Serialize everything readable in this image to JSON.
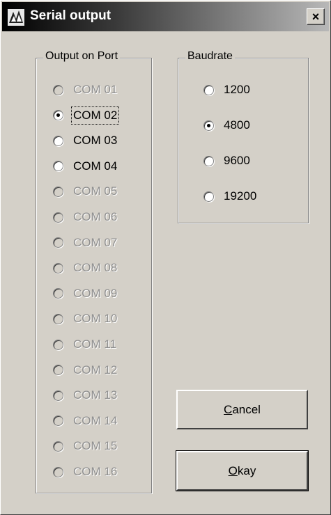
{
  "window": {
    "title": "Serial output",
    "close_symbol": "×"
  },
  "port_group": {
    "legend": "Output on Port",
    "options": [
      {
        "label": "COM 01",
        "enabled": false,
        "checked": false
      },
      {
        "label": "COM 02",
        "enabled": true,
        "checked": true,
        "focused": true
      },
      {
        "label": "COM 03",
        "enabled": true,
        "checked": false
      },
      {
        "label": "COM 04",
        "enabled": true,
        "checked": false
      },
      {
        "label": "COM 05",
        "enabled": false,
        "checked": false
      },
      {
        "label": "COM 06",
        "enabled": false,
        "checked": false
      },
      {
        "label": "COM 07",
        "enabled": false,
        "checked": false
      },
      {
        "label": "COM 08",
        "enabled": false,
        "checked": false
      },
      {
        "label": "COM 09",
        "enabled": false,
        "checked": false
      },
      {
        "label": "COM 10",
        "enabled": false,
        "checked": false
      },
      {
        "label": "COM 11",
        "enabled": false,
        "checked": false
      },
      {
        "label": "COM 12",
        "enabled": false,
        "checked": false
      },
      {
        "label": "COM 13",
        "enabled": false,
        "checked": false
      },
      {
        "label": "COM 14",
        "enabled": false,
        "checked": false
      },
      {
        "label": "COM 15",
        "enabled": false,
        "checked": false
      },
      {
        "label": "COM 16",
        "enabled": false,
        "checked": false
      }
    ]
  },
  "baud_group": {
    "legend": "Baudrate",
    "options": [
      {
        "label": "1200",
        "checked": false
      },
      {
        "label": "4800",
        "checked": true
      },
      {
        "label": "9600",
        "checked": false
      },
      {
        "label": "19200",
        "checked": false
      }
    ]
  },
  "buttons": {
    "cancel": {
      "accel": "C",
      "rest": "ancel"
    },
    "okay": {
      "accel": "O",
      "rest": "kay"
    }
  },
  "colors": {
    "face": "#d4d0c8",
    "disabled_text": "#8f8f8f"
  },
  "icons": {
    "app": "app-icon",
    "close": "close-icon"
  }
}
